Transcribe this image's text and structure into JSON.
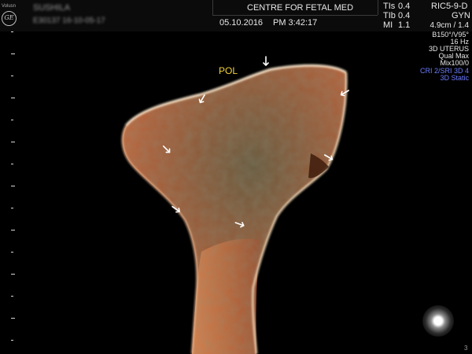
{
  "header": {
    "patient_name": "SUSHILA",
    "patient_id": "E30137 16-10-05-17",
    "institution": "CENTRE FOR FETAL MED",
    "date": "05.10.2016",
    "time": "PM 3:42:17",
    "indices": [
      {
        "label": "TIs",
        "value": "0.4"
      },
      {
        "label": "TIb",
        "value": "0.4"
      },
      {
        "label": "MI",
        "value": "1.1"
      }
    ],
    "probe": "RIC5-9-D",
    "preset": "GYN"
  },
  "logo_text": "GE",
  "side_label": "Volusn",
  "right_panel": {
    "lines": [
      "4.9cm / 1.4",
      "B150°/V95°",
      "16 Hz",
      "3D UTERUS",
      "Qual Max",
      "Mix100/0"
    ],
    "highlight_lines": [
      "CRI 2/SRI 3D 4",
      "3D Static"
    ],
    "highlight_color": "#6c7cff"
  },
  "annotation": {
    "label": "POL",
    "color": "#f2d23a"
  },
  "colors": {
    "tissue": "#b5603a",
    "background": "#000000"
  },
  "corner_text": "3"
}
